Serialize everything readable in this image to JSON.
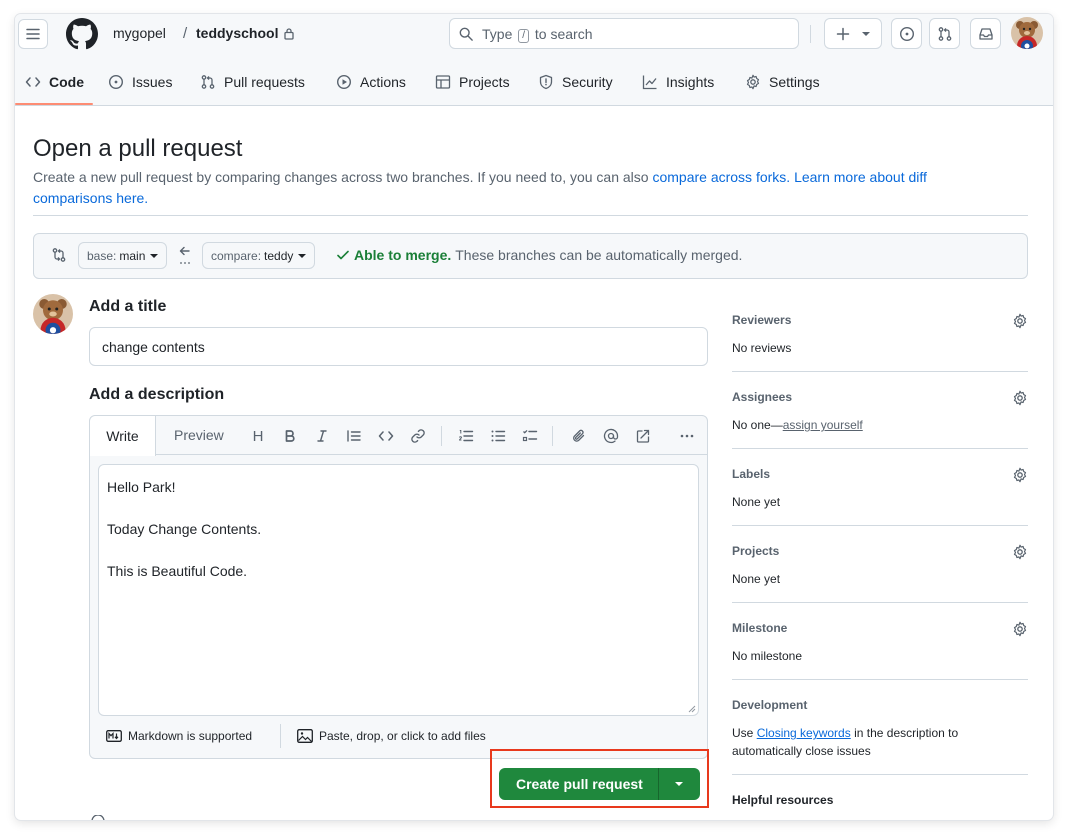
{
  "header": {
    "owner": "mygopel",
    "separator": "/",
    "repo": "teddyschool",
    "search": {
      "prefix": "Type",
      "key": "/",
      "suffix": "to search"
    }
  },
  "nav": {
    "tabs": [
      {
        "label": "Code",
        "icon": "code-icon",
        "active": true
      },
      {
        "label": "Issues",
        "icon": "issue-icon"
      },
      {
        "label": "Pull requests",
        "icon": "pull-request-icon"
      },
      {
        "label": "Actions",
        "icon": "play-icon"
      },
      {
        "label": "Projects",
        "icon": "table-icon"
      },
      {
        "label": "Security",
        "icon": "shield-icon"
      },
      {
        "label": "Insights",
        "icon": "graph-icon"
      },
      {
        "label": "Settings",
        "icon": "gear-icon"
      }
    ]
  },
  "page": {
    "title": "Open a pull request",
    "intro": "Create a new pull request by comparing changes across two branches. If you need to, you can also",
    "link_forks": "compare across forks.",
    "link_learn": "Learn more about diff comparisons here."
  },
  "range": {
    "base_prefix": "base:",
    "base_branch": "main",
    "compare_prefix": "compare:",
    "compare_branch": "teddy",
    "merge_status": "Able to merge.",
    "merge_text": "These branches can be automatically merged."
  },
  "form": {
    "title_label": "Add a title",
    "title_value": "change contents",
    "description_label": "Add a description",
    "tab_write": "Write",
    "tab_preview": "Preview",
    "heading_glyph": "H",
    "body_lines": [
      "Hello Park!",
      "",
      "Today Change Contents.",
      "",
      "This is Beautiful Code."
    ],
    "markdown_note": "Markdown is supported",
    "attach_note": "Paste, drop, or click to add files",
    "submit_label": "Create pull request"
  },
  "sidebar": {
    "reviewers": {
      "title": "Reviewers",
      "value": "No reviews"
    },
    "assignees": {
      "title": "Assignees",
      "value_prefix": "No one—",
      "value_link": "assign yourself"
    },
    "labels": {
      "title": "Labels",
      "value": "None yet"
    },
    "projects": {
      "title": "Projects",
      "value": "None yet"
    },
    "milestone": {
      "title": "Milestone",
      "value": "No milestone"
    },
    "development": {
      "title": "Development",
      "prefix": "Use",
      "link": "Closing keywords",
      "suffix": "in the description to automatically close issues"
    },
    "helpful": {
      "title": "Helpful resources"
    }
  },
  "colors": {
    "accent_link": "#0969da",
    "primary_button": "#1f883d",
    "merge_ok": "#1a7f37",
    "highlight_box": "#e8391d",
    "tab_underline": "#fd8c73"
  }
}
